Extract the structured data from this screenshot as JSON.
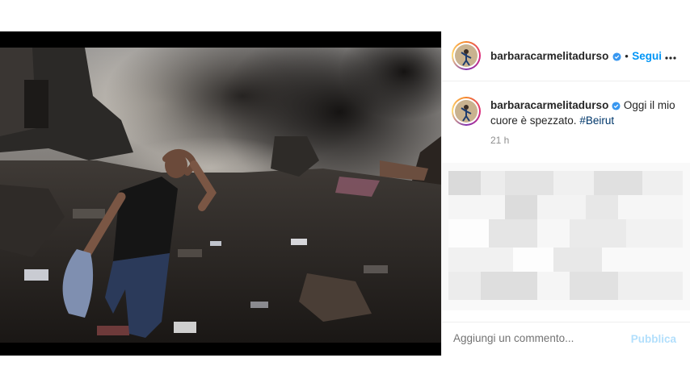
{
  "post": {
    "author": {
      "username": "barbaracarmelitadurso",
      "verified": true,
      "avatar": "user-avatar"
    },
    "header": {
      "follow_label": "Segui",
      "separator": "•",
      "more_icon": "more-horizontal-icon"
    },
    "caption": {
      "text": "Oggi il mio cuore è spezzato.",
      "hashtag": "#Beirut",
      "time": "21 h"
    },
    "image": {
      "description_icon": "post-photo"
    },
    "comment_box": {
      "placeholder": "Aggiungi un commento...",
      "publish_label": "Pubblica"
    }
  },
  "colors": {
    "link": "#0095f6",
    "hashtag": "#00376b",
    "muted": "#8e8e8e",
    "publish_disabled": "#b2dffc",
    "verified_badge": "#3897f0"
  }
}
